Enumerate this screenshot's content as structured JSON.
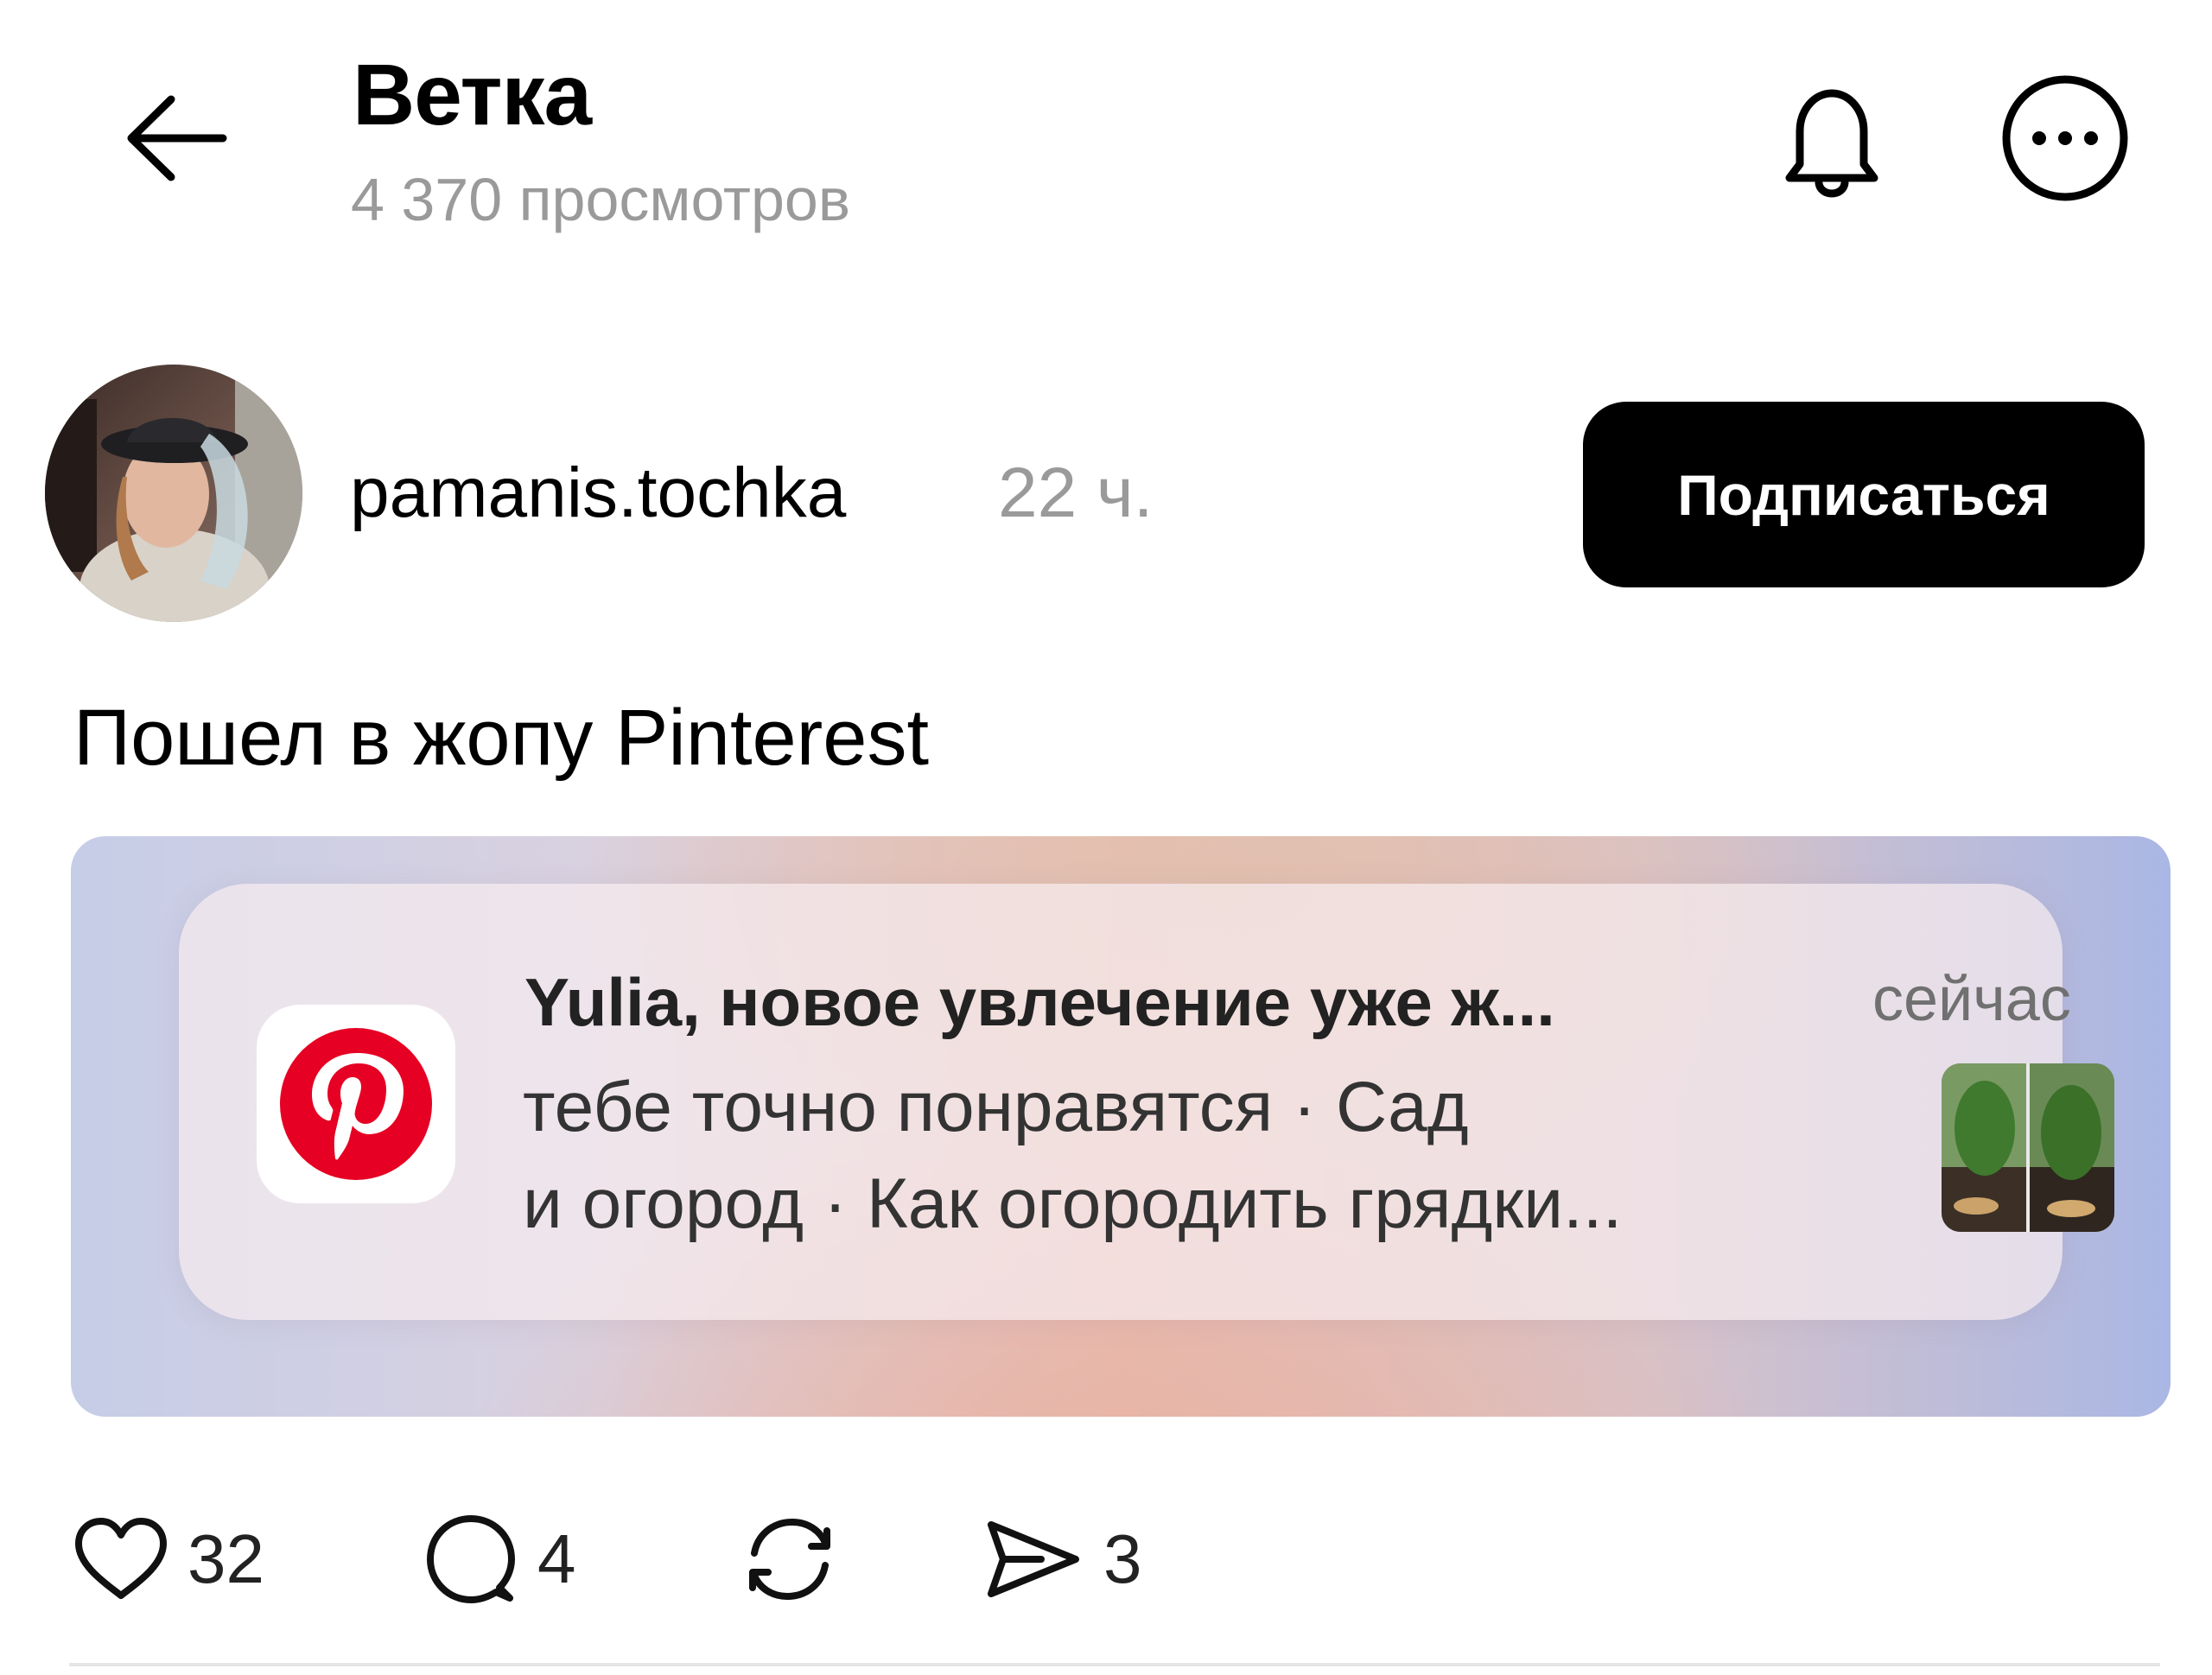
{
  "header": {
    "title": "Ветка",
    "views": "4 370 просмотров",
    "icons": [
      "arrow-left",
      "bell",
      "more-horizontal"
    ]
  },
  "author": {
    "username": "pamanis.tochka",
    "time": "22 ч.",
    "subscribe_label": "Подписаться"
  },
  "post": {
    "text": "Пошел в жопу Pinterest"
  },
  "embed": {
    "notification": {
      "app": "Pinterest",
      "title": "Yulia, новое увлечение уже ж...",
      "time": "сейчас",
      "body_line1": "тебе точно понравятся · Сад",
      "body_line2": "и огород · Как огородить грядки..."
    }
  },
  "actions": {
    "likes": "32",
    "comments": "4",
    "shares": "3"
  },
  "colors": {
    "pinterest_red": "#e60023",
    "subscribe_bg": "#000000",
    "secondary_text": "#9a9a9a"
  }
}
